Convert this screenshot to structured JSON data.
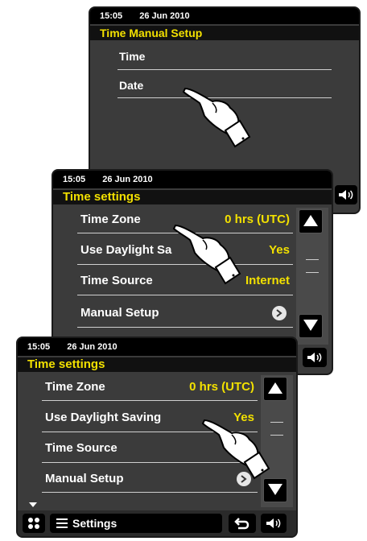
{
  "screen1": {
    "time": "15:05",
    "date": "26 Jun 2010",
    "title": "Time Manual Setup",
    "items": [
      {
        "label": "Time"
      },
      {
        "label": "Date"
      }
    ]
  },
  "screen2": {
    "time": "15:05",
    "date": "26 Jun 2010",
    "title": "Time settings",
    "items": [
      {
        "label": "Time Zone",
        "value": "0 hrs (UTC)"
      },
      {
        "label": "Use Daylight Sa",
        "value": "Yes"
      },
      {
        "label": "Time Source",
        "value": "Internet"
      },
      {
        "label": "Manual Setup",
        "value": ""
      }
    ]
  },
  "screen3": {
    "time": "15:05",
    "date": "26 Jun 2010",
    "title": "Time settings",
    "items": [
      {
        "label": "Time Zone",
        "value": "0 hrs (UTC)"
      },
      {
        "label": "Use Daylight Saving",
        "value": "Yes"
      },
      {
        "label": "Time Source",
        "value": "In"
      },
      {
        "label": "Manual Setup",
        "value": ""
      }
    ],
    "menu_label": "Settings"
  },
  "colors": {
    "screen_bg": "#3b3b3b",
    "title_text": "#f2e000",
    "value_text": "#f2e000"
  },
  "icons": [
    "up-arrow-icon",
    "down-arrow-icon",
    "chevron-right-icon",
    "volume-icon",
    "home-grid-icon",
    "menu-icon",
    "back-icon",
    "pointing-hand-icon"
  ]
}
